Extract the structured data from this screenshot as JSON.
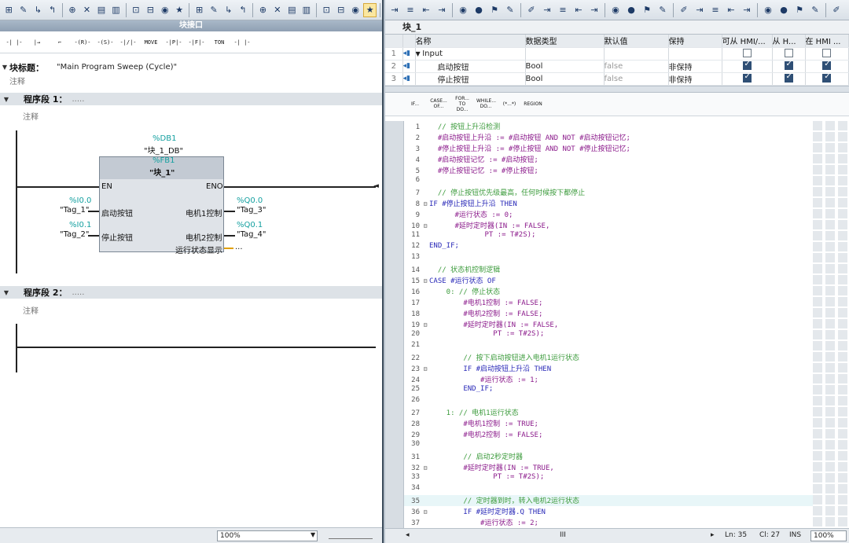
{
  "left": {
    "interface_label": "块接口",
    "toolbar_icons": [
      "network-icon",
      "comment-icon",
      "open-branch-icon",
      "close-branch-icon",
      "insert-network-icon",
      "delete-icon",
      "expand-icon",
      "collapse-icon",
      "absolute-icon",
      "symbol-icon",
      "monitor-icon",
      "favorites-icon"
    ],
    "instructions": [
      "-|  |-",
      "|→",
      "⌐",
      "-(R)-",
      "-(S)-",
      "-|/|-",
      "MOVE",
      "-|P|-",
      "-|F|-",
      "TON",
      "-| |-"
    ],
    "block_title": {
      "label": "块标题：",
      "value": "\"Main Program Sweep (Cycle)\"",
      "comment": "注释"
    },
    "network1": {
      "label": "程序段 1：",
      "dots": ".....",
      "comment": "注释"
    },
    "network2": {
      "label": "程序段 2：",
      "dots": ".....",
      "comment": "注释"
    },
    "fb": {
      "db_addr": "%DB1",
      "db_name": "\"块_1_DB\"",
      "fb_addr": "%FB1",
      "fb_name": "\"块_1\"",
      "en": "EN",
      "eno": "ENO",
      "in1": "启动按钮",
      "in2": "停止按钮",
      "out1": "电机1控制",
      "out2": "电机2控制",
      "out3": "运行状态显示",
      "out3_val": "...",
      "tag_in1_addr": "%I0.0",
      "tag_in1": "\"Tag_1\"",
      "tag_in2_addr": "%I0.1",
      "tag_in2": "\"Tag_2\"",
      "tag_out1_addr": "%Q0.0",
      "tag_out1": "\"Tag_3\"",
      "tag_out2_addr": "%Q0.1",
      "tag_out2": "\"Tag_4\""
    },
    "zoom": "100%"
  },
  "right": {
    "toolbar_icons": [
      "insert-row-icon",
      "add-row-icon",
      "indent-icon",
      "outdent-icon",
      "monitor-icon",
      "breakpoint-icon",
      "bookmark-icon",
      "comment-icon",
      "uncomment-icon"
    ],
    "block_name": "块_1",
    "interface": {
      "headers": [
        "名称",
        "数据类型",
        "默认值",
        "保持",
        "可从 HMI/...",
        "从 H...",
        "在 HMI ..."
      ],
      "section": {
        "num": "1",
        "name": "Input"
      },
      "rows": [
        {
          "num": "2",
          "name": "启动按钮",
          "type": "Bool",
          "default": "false",
          "retain": "非保持",
          "c1": true,
          "c2": true,
          "c3": true
        },
        {
          "num": "3",
          "name": "停止按钮",
          "type": "Bool",
          "default": "false",
          "retain": "非保持",
          "c1": true,
          "c2": true,
          "c3": true
        }
      ],
      "section_c1": false,
      "section_c2": false,
      "section_c3": false
    },
    "scl_templates": [
      "IF...",
      "CASE... OF...",
      "FOR... TO DO...",
      "WHILE... DO...",
      "(*...*)",
      "REGION"
    ],
    "code": [
      {
        "n": "1",
        "fold": "",
        "t": "  // 按钮上升沿检测",
        "c": "#3c9b3c"
      },
      {
        "n": "2",
        "fold": "",
        "t": "  #启动按钮上升沿 := #启动按钮 AND NOT #启动按钮记忆;",
        "c": "#8b1a8b"
      },
      {
        "n": "3",
        "fold": "",
        "t": "  #停止按钮上升沿 := #停止按钮 AND NOT #停止按钮记忆;",
        "c": "#8b1a8b"
      },
      {
        "n": "4",
        "fold": "",
        "t": "  #启动按钮记忆 := #启动按钮;",
        "c": "#8b1a8b"
      },
      {
        "n": "5",
        "fold": "",
        "t": "  #停止按钮记忆 := #停止按钮;",
        "c": "#8b1a8b"
      },
      {
        "n": "6",
        "fold": "",
        "t": "",
        "c": "#222"
      },
      {
        "n": "7",
        "fold": "",
        "t": "  // 停止按钮优先级最高，任何时候按下都停止",
        "c": "#3c9b3c"
      },
      {
        "n": "8",
        "fold": "⊟",
        "t": "IF #停止按钮上升沿 THEN",
        "c": "#2a2ab8"
      },
      {
        "n": "9",
        "fold": "",
        "t": "      #运行状态 := 0;",
        "c": "#8b1a8b"
      },
      {
        "n": "10",
        "fold": "⊟",
        "t": "      #延时定时器(IN := FALSE,",
        "c": "#8b1a8b"
      },
      {
        "n": "11",
        "fold": "",
        "t": "             PT := T#2S);",
        "c": "#8b1a8b"
      },
      {
        "n": "12",
        "fold": "",
        "t": "END_IF;",
        "c": "#2a2ab8"
      },
      {
        "n": "13",
        "fold": "",
        "t": "",
        "c": "#222"
      },
      {
        "n": "14",
        "fold": "",
        "t": "  // 状态机控制逻辑",
        "c": "#3c9b3c"
      },
      {
        "n": "15",
        "fold": "⊟",
        "t": "CASE #运行状态 OF",
        "c": "#2a2ab8"
      },
      {
        "n": "16",
        "fold": "",
        "t": "    0: // 停止状态",
        "c": "#3c9b3c"
      },
      {
        "n": "17",
        "fold": "",
        "t": "        #电机1控制 := FALSE;",
        "c": "#8b1a8b"
      },
      {
        "n": "18",
        "fold": "",
        "t": "        #电机2控制 := FALSE;",
        "c": "#8b1a8b"
      },
      {
        "n": "19",
        "fold": "⊟",
        "t": "        #延时定时器(IN := FALSE,",
        "c": "#8b1a8b"
      },
      {
        "n": "20",
        "fold": "",
        "t": "               PT := T#2S);",
        "c": "#8b1a8b"
      },
      {
        "n": "21",
        "fold": "",
        "t": "",
        "c": "#222"
      },
      {
        "n": "22",
        "fold": "",
        "t": "        // 按下启动按钮进入电机1运行状态",
        "c": "#3c9b3c"
      },
      {
        "n": "23",
        "fold": "⊟",
        "t": "        IF #启动按钮上升沿 THEN",
        "c": "#2a2ab8"
      },
      {
        "n": "24",
        "fold": "",
        "t": "            #运行状态 := 1;",
        "c": "#8b1a8b"
      },
      {
        "n": "25",
        "fold": "",
        "t": "        END_IF;",
        "c": "#2a2ab8"
      },
      {
        "n": "26",
        "fold": "",
        "t": "",
        "c": "#222"
      },
      {
        "n": "27",
        "fold": "",
        "t": "    1: // 电机1运行状态",
        "c": "#3c9b3c"
      },
      {
        "n": "28",
        "fold": "",
        "t": "        #电机1控制 := TRUE;",
        "c": "#8b1a8b"
      },
      {
        "n": "29",
        "fold": "",
        "t": "        #电机2控制 := FALSE;",
        "c": "#8b1a8b"
      },
      {
        "n": "30",
        "fold": "",
        "t": "",
        "c": "#222"
      },
      {
        "n": "31",
        "fold": "",
        "t": "        // 启动2秒定时器",
        "c": "#3c9b3c"
      },
      {
        "n": "32",
        "fold": "⊟",
        "t": "        #延时定时器(IN := TRUE,",
        "c": "#8b1a8b"
      },
      {
        "n": "33",
        "fold": "",
        "t": "               PT := T#2S);",
        "c": "#8b1a8b"
      },
      {
        "n": "34",
        "fold": "",
        "t": "",
        "c": "#222"
      },
      {
        "n": "35",
        "fold": "",
        "t": "        // 定时器到时，转入电机2运行状态",
        "c": "#3c9b3c"
      },
      {
        "n": "36",
        "fold": "⊟",
        "t": "        IF #延时定时器.Q THEN",
        "c": "#2a2ab8"
      },
      {
        "n": "37",
        "fold": "",
        "t": "            #运行状态 := 2;",
        "c": "#8b1a8b"
      }
    ],
    "status": {
      "ln": "Ln: 35",
      "col": "Cl: 27",
      "mode": "INS",
      "zoom": "100%"
    }
  }
}
